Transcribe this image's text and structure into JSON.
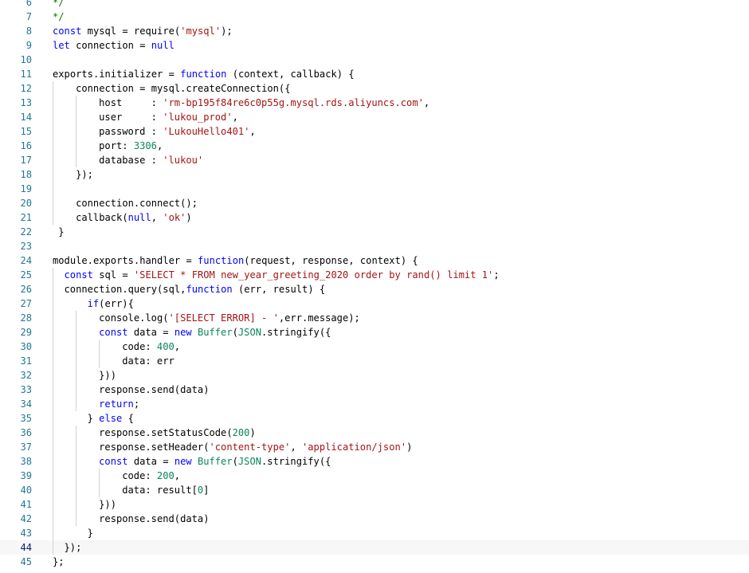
{
  "editor": {
    "current_line": 44,
    "colors": {
      "keyword": "#0000ff",
      "string": "#a31515",
      "number": "#098658",
      "comment": "#008000",
      "line_number": "#237893",
      "current_line_number": "#0b216f"
    },
    "lines": [
      {
        "n": "6",
        "indent": 0,
        "tokens": [
          {
            "t": "c",
            "v": "*/"
          }
        ]
      },
      {
        "n": "7",
        "indent": 0,
        "tokens": [
          {
            "t": "c",
            "v": "*/"
          }
        ]
      },
      {
        "n": "8",
        "indent": 0,
        "tokens": [
          {
            "t": "k",
            "v": "const"
          },
          {
            "t": "p",
            "v": " mysql = require("
          },
          {
            "t": "s",
            "v": "'mysql'"
          },
          {
            "t": "p",
            "v": ");"
          }
        ]
      },
      {
        "n": "9",
        "indent": 0,
        "tokens": [
          {
            "t": "k",
            "v": "let"
          },
          {
            "t": "p",
            "v": " connection = "
          },
          {
            "t": "k",
            "v": "null"
          }
        ]
      },
      {
        "n": "10",
        "indent": 0,
        "tokens": []
      },
      {
        "n": "11",
        "indent": 0,
        "tokens": [
          {
            "t": "p",
            "v": "exports.initializer = "
          },
          {
            "t": "k",
            "v": "function"
          },
          {
            "t": "p",
            "v": " (context, callback) {"
          }
        ]
      },
      {
        "n": "12",
        "indent": 4,
        "tokens": [
          {
            "t": "p",
            "v": "connection = mysql.createConnection({"
          }
        ]
      },
      {
        "n": "13",
        "indent": 8,
        "tokens": [
          {
            "t": "p",
            "v": "host     : "
          },
          {
            "t": "s",
            "v": "'rm-bp195f84re6c0p55g.mysql.rds.aliyuncs.com'"
          },
          {
            "t": "p",
            "v": ","
          }
        ]
      },
      {
        "n": "14",
        "indent": 8,
        "tokens": [
          {
            "t": "p",
            "v": "user     : "
          },
          {
            "t": "s",
            "v": "'lukou_prod'"
          },
          {
            "t": "p",
            "v": ","
          }
        ]
      },
      {
        "n": "15",
        "indent": 8,
        "tokens": [
          {
            "t": "p",
            "v": "password : "
          },
          {
            "t": "s",
            "v": "'LukouHello401'"
          },
          {
            "t": "p",
            "v": ","
          }
        ]
      },
      {
        "n": "16",
        "indent": 8,
        "tokens": [
          {
            "t": "p",
            "v": "port: "
          },
          {
            "t": "n",
            "v": "3306"
          },
          {
            "t": "p",
            "v": ","
          }
        ]
      },
      {
        "n": "17",
        "indent": 8,
        "tokens": [
          {
            "t": "p",
            "v": "database : "
          },
          {
            "t": "s",
            "v": "'lukou'"
          }
        ]
      },
      {
        "n": "18",
        "indent": 4,
        "tokens": [
          {
            "t": "p",
            "v": "});"
          }
        ]
      },
      {
        "n": "19",
        "indent": 0,
        "tokens": []
      },
      {
        "n": "20",
        "indent": 4,
        "tokens": [
          {
            "t": "p",
            "v": "connection.connect();"
          }
        ]
      },
      {
        "n": "21",
        "indent": 4,
        "tokens": [
          {
            "t": "p",
            "v": "callback("
          },
          {
            "t": "k",
            "v": "null"
          },
          {
            "t": "p",
            "v": ", "
          },
          {
            "t": "s",
            "v": "'ok'"
          },
          {
            "t": "p",
            "v": ")"
          }
        ]
      },
      {
        "n": "22",
        "indent": 1,
        "tokens": [
          {
            "t": "p",
            "v": "}"
          }
        ]
      },
      {
        "n": "23",
        "indent": 0,
        "tokens": []
      },
      {
        "n": "24",
        "indent": 0,
        "tokens": [
          {
            "t": "p",
            "v": "module.exports.handler = "
          },
          {
            "t": "k",
            "v": "function"
          },
          {
            "t": "p",
            "v": "(request, response, context) {"
          }
        ]
      },
      {
        "n": "25",
        "indent": 2,
        "tokens": [
          {
            "t": "k",
            "v": "const"
          },
          {
            "t": "p",
            "v": " sql = "
          },
          {
            "t": "s",
            "v": "'SELECT * FROM new_year_greeting_2020 order by rand() limit 1'"
          },
          {
            "t": "p",
            "v": ";"
          }
        ]
      },
      {
        "n": "26",
        "indent": 2,
        "tokens": [
          {
            "t": "p",
            "v": "connection.query(sql,"
          },
          {
            "t": "k",
            "v": "function"
          },
          {
            "t": "p",
            "v": " (err, result) {"
          }
        ]
      },
      {
        "n": "27",
        "indent": 6,
        "tokens": [
          {
            "t": "k",
            "v": "if"
          },
          {
            "t": "p",
            "v": "(err){"
          }
        ]
      },
      {
        "n": "28",
        "indent": 8,
        "tokens": [
          {
            "t": "p",
            "v": "console.log("
          },
          {
            "t": "s",
            "v": "'[SELECT ERROR] - '"
          },
          {
            "t": "p",
            "v": ",err.message);"
          }
        ]
      },
      {
        "n": "29",
        "indent": 8,
        "tokens": [
          {
            "t": "k",
            "v": "const"
          },
          {
            "t": "p",
            "v": " data = "
          },
          {
            "t": "k",
            "v": "new"
          },
          {
            "t": "p",
            "v": " "
          },
          {
            "t": "n",
            "v": "Buffer"
          },
          {
            "t": "p",
            "v": "("
          },
          {
            "t": "n",
            "v": "JSON"
          },
          {
            "t": "p",
            "v": ".stringify({"
          }
        ]
      },
      {
        "n": "30",
        "indent": 12,
        "tokens": [
          {
            "t": "p",
            "v": "code: "
          },
          {
            "t": "n",
            "v": "400"
          },
          {
            "t": "p",
            "v": ","
          }
        ]
      },
      {
        "n": "31",
        "indent": 12,
        "tokens": [
          {
            "t": "p",
            "v": "data: err"
          }
        ]
      },
      {
        "n": "32",
        "indent": 8,
        "tokens": [
          {
            "t": "p",
            "v": "}))"
          }
        ]
      },
      {
        "n": "33",
        "indent": 8,
        "tokens": [
          {
            "t": "p",
            "v": "response.send(data)"
          }
        ]
      },
      {
        "n": "34",
        "indent": 8,
        "tokens": [
          {
            "t": "k",
            "v": "return"
          },
          {
            "t": "p",
            "v": ";"
          }
        ]
      },
      {
        "n": "35",
        "indent": 6,
        "tokens": [
          {
            "t": "p",
            "v": "} "
          },
          {
            "t": "k",
            "v": "else"
          },
          {
            "t": "p",
            "v": " {"
          }
        ]
      },
      {
        "n": "36",
        "indent": 8,
        "tokens": [
          {
            "t": "p",
            "v": "response.setStatusCode("
          },
          {
            "t": "n",
            "v": "200"
          },
          {
            "t": "p",
            "v": ")"
          }
        ]
      },
      {
        "n": "37",
        "indent": 8,
        "tokens": [
          {
            "t": "p",
            "v": "response.setHeader("
          },
          {
            "t": "s",
            "v": "'content-type'"
          },
          {
            "t": "p",
            "v": ", "
          },
          {
            "t": "s",
            "v": "'application/json'"
          },
          {
            "t": "p",
            "v": ")"
          }
        ]
      },
      {
        "n": "38",
        "indent": 8,
        "tokens": [
          {
            "t": "k",
            "v": "const"
          },
          {
            "t": "p",
            "v": " data = "
          },
          {
            "t": "k",
            "v": "new"
          },
          {
            "t": "p",
            "v": " "
          },
          {
            "t": "n",
            "v": "Buffer"
          },
          {
            "t": "p",
            "v": "("
          },
          {
            "t": "n",
            "v": "JSON"
          },
          {
            "t": "p",
            "v": ".stringify({"
          }
        ]
      },
      {
        "n": "39",
        "indent": 12,
        "tokens": [
          {
            "t": "p",
            "v": "code: "
          },
          {
            "t": "n",
            "v": "200"
          },
          {
            "t": "p",
            "v": ","
          }
        ]
      },
      {
        "n": "40",
        "indent": 12,
        "tokens": [
          {
            "t": "p",
            "v": "data: result["
          },
          {
            "t": "n",
            "v": "0"
          },
          {
            "t": "p",
            "v": "]"
          }
        ]
      },
      {
        "n": "41",
        "indent": 8,
        "tokens": [
          {
            "t": "p",
            "v": "}))"
          }
        ]
      },
      {
        "n": "42",
        "indent": 8,
        "tokens": [
          {
            "t": "p",
            "v": "response.send(data)"
          }
        ]
      },
      {
        "n": "43",
        "indent": 6,
        "tokens": [
          {
            "t": "p",
            "v": "}"
          }
        ]
      },
      {
        "n": "44",
        "indent": 2,
        "tokens": [
          {
            "t": "p",
            "v": "});"
          }
        ]
      },
      {
        "n": "45",
        "indent": 0,
        "tokens": [
          {
            "t": "p",
            "v": "};"
          }
        ]
      }
    ]
  }
}
